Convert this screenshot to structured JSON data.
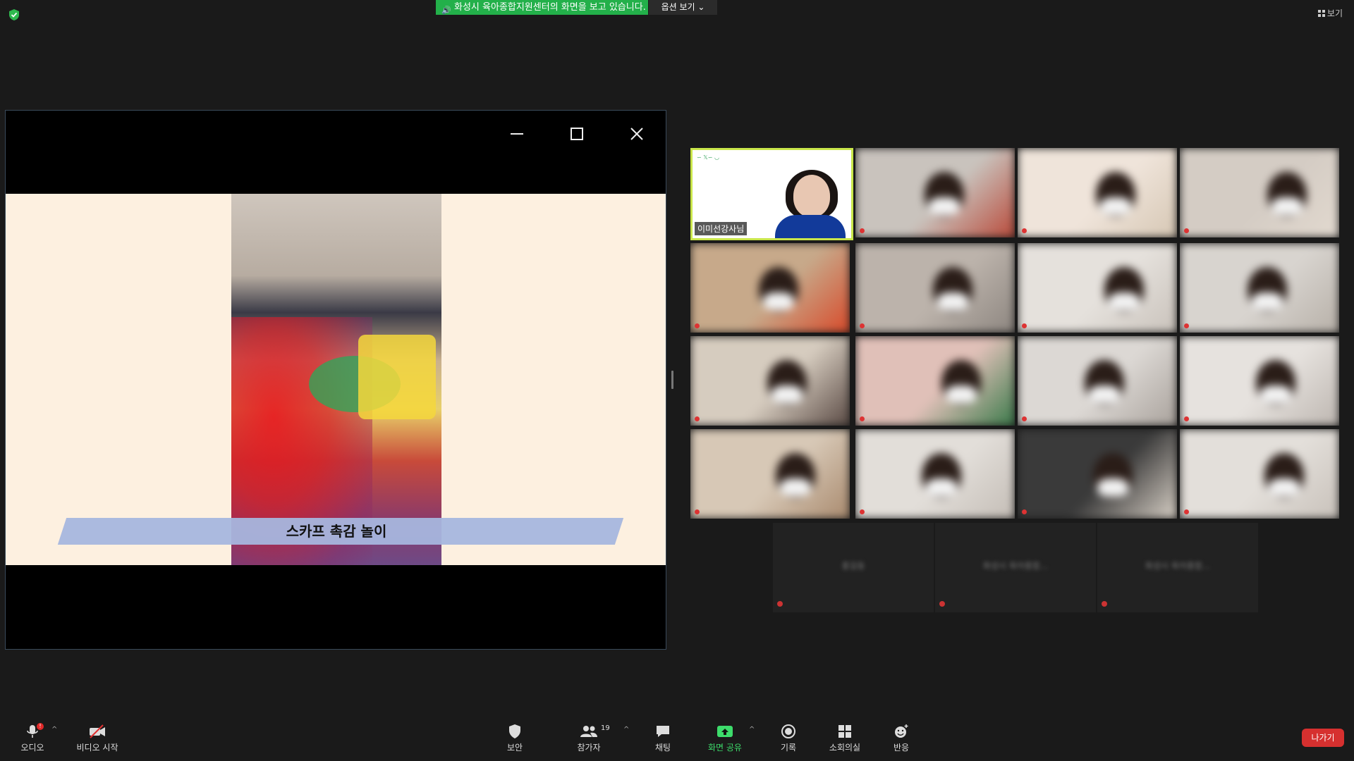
{
  "top_bar": {
    "share_banner": "화성시 육아종합지원센터의 화면을 보고 있습니다.",
    "view_options": "옵션 보기 ⌄",
    "view_button": "보기"
  },
  "shared_screen": {
    "slide_caption": "스카프 촉감 놀이"
  },
  "gallery": {
    "host_name": "이미선강사님",
    "empty_tiles": [
      "홍길동",
      "화성시 육아종합...",
      "화성시 육아종합..."
    ]
  },
  "toolbar": {
    "audio_label": "오디오",
    "audio_badge": "!",
    "video_label": "비디오 시작",
    "security_label": "보안",
    "participants_label": "참가자",
    "participants_count": "19",
    "chat_label": "채팅",
    "share_label": "화면 공유",
    "record_label": "기록",
    "breakout_label": "소회의실",
    "reactions_label": "반응",
    "leave_label": "나가기"
  },
  "colors": {
    "share_banner_bg": "#23b04a",
    "host_border": "#c9e64a",
    "leave_bg": "#d6302f",
    "share_icon": "#3ddc6b"
  }
}
